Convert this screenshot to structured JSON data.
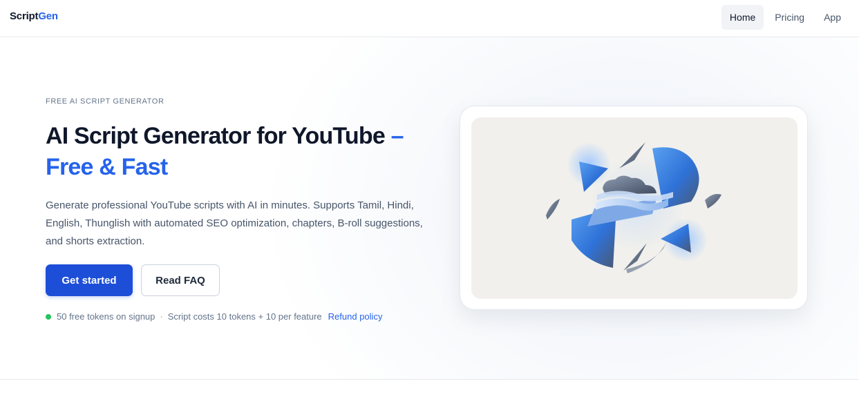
{
  "brand": {
    "name_part1": "Script",
    "name_part2": "Gen"
  },
  "nav": {
    "items": [
      {
        "label": "Home"
      },
      {
        "label": "Pricing"
      },
      {
        "label": "App"
      }
    ]
  },
  "hero": {
    "eyebrow": "FREE AI SCRIPT GENERATOR",
    "headline_main": "AI Script Generator for YouTube",
    "headline_accent": "– Free & Fast",
    "description": "Generate professional YouTube scripts with AI in minutes. Supports Tamil, Hindi, English, Thunglish with automated SEO optimization, chapters, B-roll suggestions, and shorts extraction.",
    "primary_button": "Get started",
    "secondary_button": "Read FAQ",
    "meta": {
      "tokens_signup": "50 free tokens on signup",
      "separator": "·",
      "script_cost": "Script costs 10 tokens + 10 per feature",
      "refund_link": "Refund policy"
    }
  },
  "colors": {
    "accent": "#2563eb",
    "primary_button": "#1d4ed8",
    "status_dot": "#22c55e"
  },
  "illustration": {
    "icon": "abstract-ai-illustration"
  }
}
